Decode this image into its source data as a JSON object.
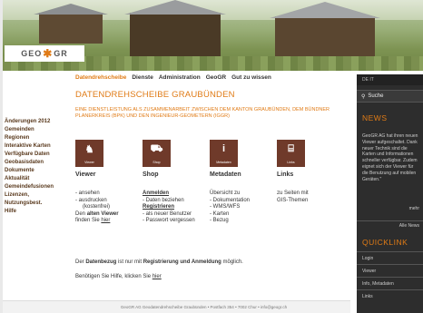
{
  "header": {
    "logo_left": "GEO",
    "logo_star": "✱",
    "logo_right": "GR"
  },
  "leftnav": [
    "Änderungen 2012",
    "Gemeinden",
    "Regionen",
    "Interaktive Karten",
    "Verfügbare Daten",
    "Geobasisdaten",
    "Dokumente",
    "Aktualität",
    "Gemeindefusionen",
    "Lizenzen,",
    "Nutzungsbest.",
    "Hilfe"
  ],
  "topmenu": [
    "Datendrehscheibe",
    "Dienste",
    "Administration",
    "GeoGR",
    "Gut zu wissen"
  ],
  "title": "DATENDREHSCHEIBE GRAUBÜNDEN",
  "subtitle": "EINE DIENSTLEISTUNG ALS ZUSAMMENARBEIT ZWISCHEN DEM KANTON GRAUBÜNDEN, DEM BÜNDNER PLANERKREIS (BPK) UND DEN INGENIEUR-GEOMETERN (IGGR)",
  "columns": {
    "viewer": {
      "tile": "Viewer",
      "head": "Viewer",
      "l1": "- ansehen",
      "l2": "- ausdrucken",
      "l3": "(kostenfrei)",
      "l4a": "Den ",
      "l4b": "alten Viewer",
      "l5a": "finden Sie ",
      "l5b": "hier"
    },
    "shop": {
      "tile": "Shop",
      "head": "Shop",
      "l1": "Anmelden",
      "l2": "- Daten beziehen",
      "l3": "Registrieren",
      "l4": "- als neuer Benutzer",
      "l5": "- Passwort vergessen"
    },
    "metadaten": {
      "tile": "Metadaten",
      "head": "Metadaten",
      "l1": "Übersicht zu",
      "l2": "- Dokumentation",
      "l3": "- WMS/WFS",
      "l4": "- Karten",
      "l5": "- Bezug"
    },
    "links": {
      "tile": "Links",
      "head": "Links",
      "l1": "zu Seiten mit",
      "l2": "GIS-Themen"
    }
  },
  "note1": {
    "a": "Der ",
    "b": "Datenbezug",
    "c": " ist nur mit ",
    "d": "Registrierung und Anmeldung",
    "e": " möglich."
  },
  "note2": {
    "a": "Benötigen Sie Hilfe, klicken Sie ",
    "b": "hier"
  },
  "footer": "GeoGR AG Geodatendrehscheibe Graubünden  •  Postfach 354  •  7002 Chur  •  info@geogr.ch",
  "sidebar": {
    "lang": "DE  IT",
    "search": "Suche",
    "news_title": "NEWS",
    "news_text": "GeoGR AG hat ihren neuen Viewer aufgeschaltet. Dank neuer Technik sind die Karten und Informationen schneller verfügbar. Zudem eignet sich der Viewer für die Benutzung auf mobilen Geräten.\"",
    "more": "mehr",
    "all_news": "Alle News",
    "quicklink_title": "QUICKLINK",
    "quicklinks": [
      "Login",
      "Viewer",
      "Info, Metadaten",
      "Links"
    ]
  }
}
